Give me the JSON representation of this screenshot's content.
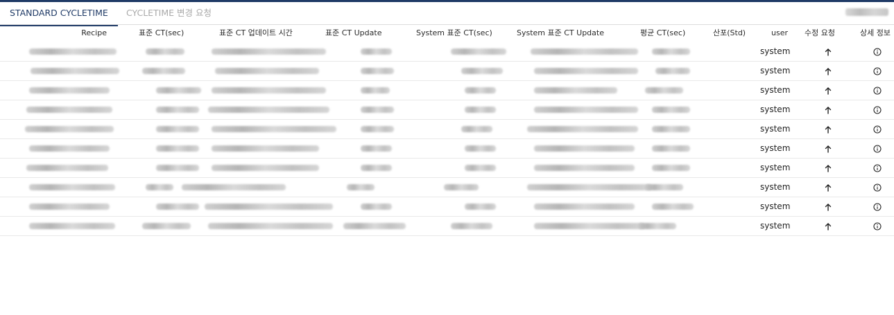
{
  "tabs": [
    {
      "label": "STANDARD CYCLETIME",
      "active": true
    },
    {
      "label": "CYCLETIME 변경 요청",
      "active": false
    }
  ],
  "table": {
    "columns": [
      "Recipe",
      "표준 CT(sec)",
      "표준 CT 업데이트 시간",
      "표준 CT Update",
      "System 표준 CT(sec)",
      "System 표준 CT Update",
      "평균 CT(sec)",
      "산포(Std)",
      "user",
      "수정 요청",
      "상세 정보"
    ],
    "rows": [
      {
        "user": "system"
      },
      {
        "user": "system"
      },
      {
        "user": "system"
      },
      {
        "user": "system"
      },
      {
        "user": "system"
      },
      {
        "user": "system"
      },
      {
        "user": "system"
      },
      {
        "user": "system"
      },
      {
        "user": "system"
      },
      {
        "user": "system"
      }
    ]
  },
  "icons": {
    "edit_request": "arrow-up-icon",
    "detail": "info-circle-icon"
  },
  "colors": {
    "accent": "#1f3a66",
    "inactive_tab": "#a9a9a9"
  }
}
